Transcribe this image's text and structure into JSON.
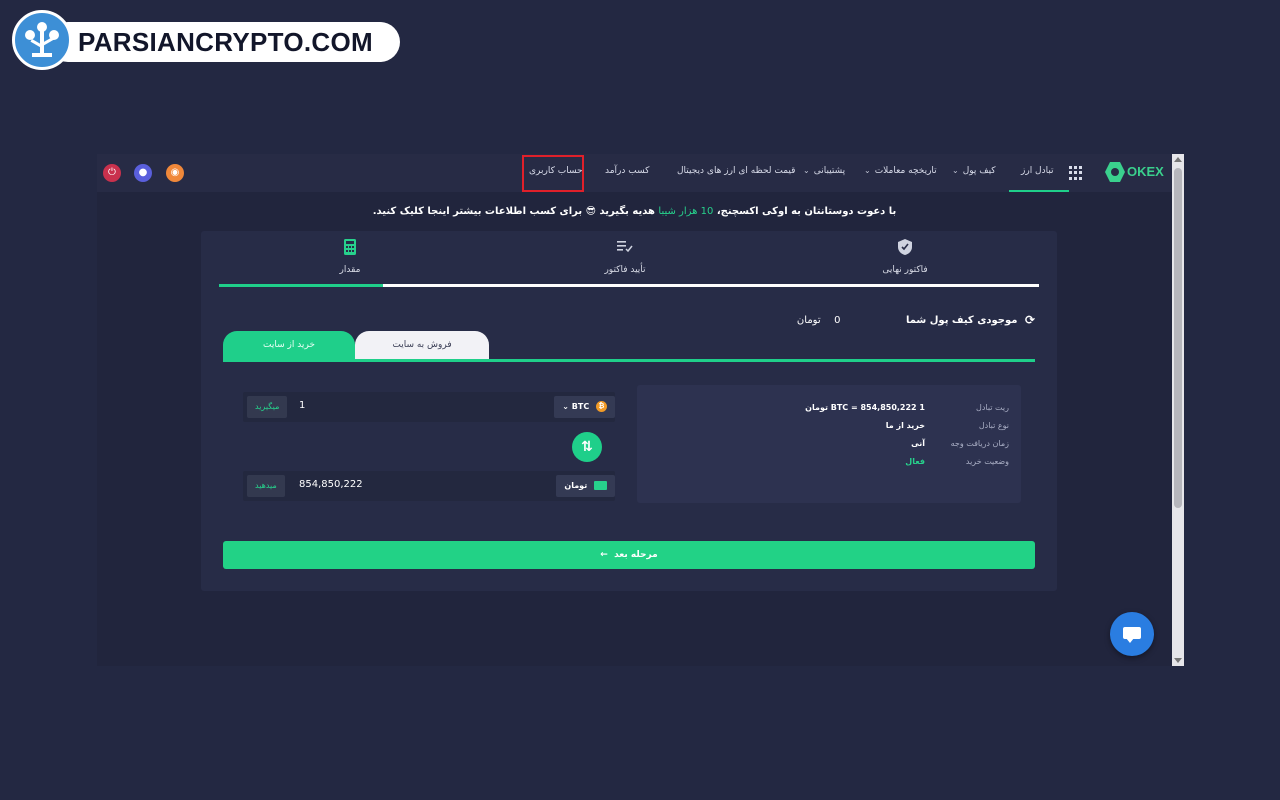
{
  "watermark": {
    "text": "PARSIANCRYPTO.COM"
  },
  "navbar": {
    "logo_text": "OKEX",
    "items": {
      "exchange": "تبادل ارز",
      "wallet": "کیف پول",
      "trade_history": "تاریخچه معاملات",
      "support": "پشتیبانی",
      "live_prices": "قیمت لحظه ای ارز های دیجیتال",
      "earn": "کسب درآمد",
      "account": "حساب کاربری"
    }
  },
  "promo": {
    "text_before": "با دعوت دوستانتان به اوکی اکسچنج،",
    "accent": "10 هزار شیبا",
    "text_after": "هدیه بگیرید 😎 برای کسب اطلاعات بیشتر اینجا کلیک کنید."
  },
  "steps": {
    "final_invoice": "فاکتور نهایی",
    "confirm_invoice": "تأیید فاکتور",
    "amount": "مقدار",
    "progress": 0.2
  },
  "balance": {
    "label": "موجودی کیف پول شما",
    "value": "0",
    "unit": "تومان"
  },
  "tabs": {
    "buy": "خرید از سایت",
    "sell": "فروش به سایت"
  },
  "info": {
    "labels": {
      "rate": "ریت تبادل",
      "type": "نوع تبادل",
      "receive_time": "زمان دریافت وجه",
      "status": "وضعیت خرید"
    },
    "values": {
      "rate": "1 BTC = 854,850,222 تومان",
      "type": "خرید از ما",
      "receive_time": "آنی",
      "status": "فعال"
    }
  },
  "receive_field": {
    "button": "میگیرید",
    "value": "1",
    "currency": "BTC"
  },
  "pay_field": {
    "button": "میدهید",
    "value": "854,850,222",
    "currency": "تومان"
  },
  "next_button": "مرحله بعد",
  "colors": {
    "accent": "#1fcf8a",
    "background": "#232842",
    "highlight_box": "#e0202a"
  }
}
